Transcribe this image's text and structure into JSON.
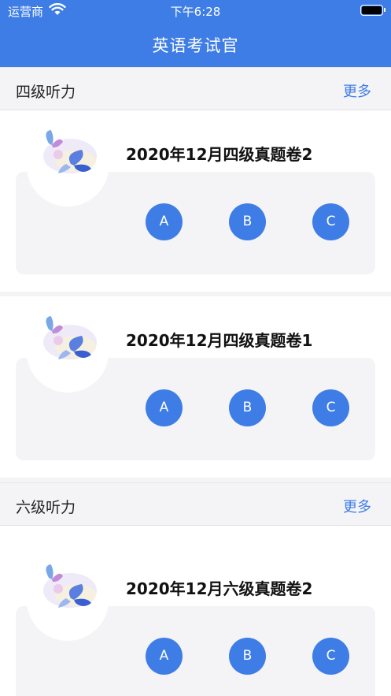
{
  "status_bar": {
    "carrier": "运营商",
    "time": "下午6:28"
  },
  "app": {
    "title": "英语考试官"
  },
  "sections": [
    {
      "title": "四级听力",
      "more": "更多",
      "cards": [
        {
          "title": "2020年12月四级真题卷2",
          "options": [
            "A",
            "B",
            "C"
          ]
        },
        {
          "title": "2020年12月四级真题卷1",
          "options": [
            "A",
            "B",
            "C"
          ]
        }
      ]
    },
    {
      "title": "六级听力",
      "more": "更多",
      "cards": [
        {
          "title": "2020年12月六级真题卷2",
          "options": [
            "A",
            "B",
            "C"
          ]
        }
      ]
    }
  ],
  "colors": {
    "accent": "#3f7de6",
    "panel": "#f4f4f6"
  },
  "icons": {
    "wifi": "wifi-icon",
    "battery": "battery-icon",
    "thumbnail": "butterfly-icon"
  }
}
